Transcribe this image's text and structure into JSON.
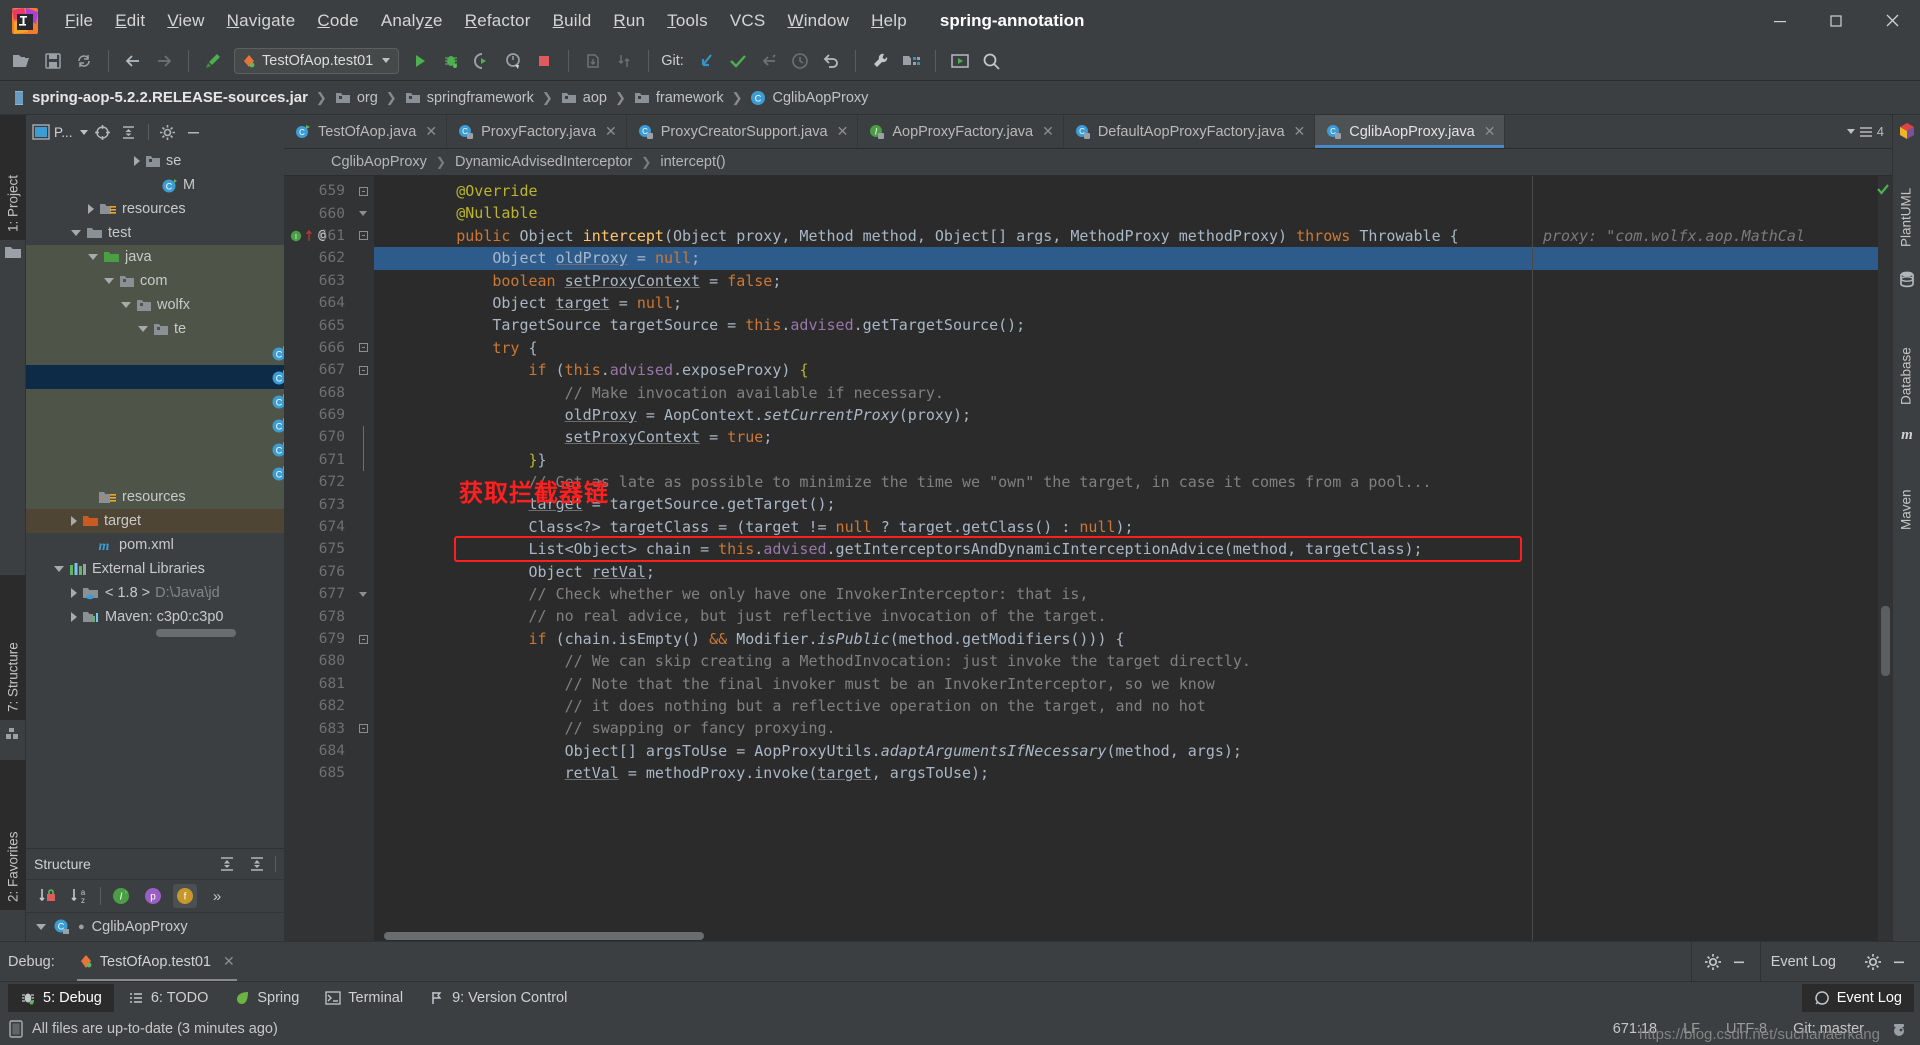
{
  "window": {
    "title": "spring-annotation",
    "minimize_label": "–",
    "maximize_label": "□",
    "close_label": "✕"
  },
  "menu": [
    {
      "label": "File",
      "mnemonic": "F"
    },
    {
      "label": "Edit",
      "mnemonic": "E"
    },
    {
      "label": "View",
      "mnemonic": "V"
    },
    {
      "label": "Navigate",
      "mnemonic": "N"
    },
    {
      "label": "Code",
      "mnemonic": "C"
    },
    {
      "label": "Analyze",
      "mnemonic": "z"
    },
    {
      "label": "Refactor",
      "mnemonic": "R"
    },
    {
      "label": "Build",
      "mnemonic": "B"
    },
    {
      "label": "Run",
      "mnemonic": "R"
    },
    {
      "label": "Tools",
      "mnemonic": "T"
    },
    {
      "label": "VCS",
      "mnemonic": ""
    },
    {
      "label": "Window",
      "mnemonic": "W"
    },
    {
      "label": "Help",
      "mnemonic": "H"
    }
  ],
  "toolbar": {
    "run_config": "TestOfAop.test01",
    "git_label": "Git:",
    "icons": [
      "open-folder-icon",
      "save-all-icon",
      "sync-icon",
      "back-arrow-icon",
      "forward-arrow-icon",
      "build-icon",
      "run-icon",
      "debug-icon",
      "run-coverage-icon",
      "profile-icon",
      "stop-icon",
      "update-project-icon",
      "commit-icon",
      "git-update-icon",
      "git-commit-check-icon",
      "git-push-icon",
      "git-history-icon",
      "git-rollback-icon",
      "settings-wrench-icon",
      "project-structure-icon",
      "run-anything-icon",
      "search-everywhere-icon"
    ]
  },
  "breadcrumb": {
    "items": [
      {
        "label": "spring-aop-5.2.2.RELEASE-sources.jar",
        "icon": "jar-icon"
      },
      {
        "label": "org",
        "icon": "package-icon"
      },
      {
        "label": "springframework",
        "icon": "package-icon"
      },
      {
        "label": "aop",
        "icon": "package-icon"
      },
      {
        "label": "framework",
        "icon": "package-icon"
      },
      {
        "label": "CglibAopProxy",
        "icon": "class-icon"
      }
    ]
  },
  "left_rail": {
    "project_tab": "1: Project",
    "structure_tab": "7: Structure",
    "favorites_tab": "2: Favorites"
  },
  "right_rail": {
    "items": [
      "PlantUML",
      "Database",
      "Maven"
    ]
  },
  "project_panel": {
    "title": "P...",
    "tree": [
      {
        "label": "se",
        "indent": 5,
        "arrow": "closed",
        "icon": "folder-icon",
        "sel": ""
      },
      {
        "label": "M",
        "indent": 6,
        "arrow": "none",
        "icon": "test-class-icon",
        "sel": ""
      },
      {
        "label": "resources",
        "indent": 3,
        "arrow": "closed",
        "icon": "resources-folder-icon",
        "sel": ""
      },
      {
        "label": "test",
        "indent": 2,
        "arrow": "open",
        "icon": "folder-icon",
        "sel": ""
      },
      {
        "label": "java",
        "indent": 3,
        "arrow": "open",
        "icon": "source-folder-green-icon",
        "sel": "sel-green"
      },
      {
        "label": "com",
        "indent": 4,
        "arrow": "open",
        "icon": "package-icon",
        "sel": "sel-green"
      },
      {
        "label": "wolfx",
        "indent": 5,
        "arrow": "open",
        "icon": "package-icon",
        "sel": "sel-green"
      },
      {
        "label": "te",
        "indent": 6,
        "arrow": "open",
        "icon": "package-icon",
        "sel": "sel-green"
      },
      {
        "label": "",
        "indent": 7,
        "arrow": "none",
        "icon": "test-class-icon",
        "sel": "sel-green"
      },
      {
        "label": "",
        "indent": 7,
        "arrow": "none",
        "icon": "test-class-icon",
        "sel": "sel-blue"
      },
      {
        "label": "",
        "indent": 7,
        "arrow": "none",
        "icon": "test-class-icon",
        "sel": "sel-green"
      },
      {
        "label": "",
        "indent": 7,
        "arrow": "none",
        "icon": "test-class-icon",
        "sel": "sel-green"
      },
      {
        "label": "",
        "indent": 7,
        "arrow": "none",
        "icon": "test-class-icon",
        "sel": "sel-green"
      },
      {
        "label": "",
        "indent": 7,
        "arrow": "none",
        "icon": "test-class-icon",
        "sel": "sel-green"
      },
      {
        "label": "resources",
        "indent": 3,
        "arrow": "none",
        "icon": "test-resources-folder-icon",
        "sel": "sel-green"
      },
      {
        "label": "target",
        "indent": 2,
        "arrow": "closed",
        "icon": "target-folder-icon",
        "sel": "sel-amber"
      },
      {
        "label": "pom.xml",
        "indent": 3,
        "arrow": "none",
        "icon": "maven-m-icon",
        "sel": ""
      },
      {
        "label": "External Libraries",
        "indent": 1,
        "arrow": "open",
        "icon": "libraries-icon",
        "sel": ""
      },
      {
        "label": "< 1.8 >",
        "sublabel": "D:\\Java\\jd",
        "indent": 2,
        "arrow": "closed",
        "icon": "jdk-icon",
        "sel": ""
      },
      {
        "label": "Maven: c3p0:c3p0",
        "indent": 2,
        "arrow": "closed",
        "icon": "maven-lib-icon",
        "sel": ""
      }
    ]
  },
  "structure_panel": {
    "title": "Structure",
    "root_item": "CglibAopProxy",
    "toolbar_icons": [
      "sort-by-visibility-icon",
      "sort-alphabetically-icon",
      "show-inherited-icon",
      "show-properties-icon",
      "show-fields-icon",
      "more-icon"
    ]
  },
  "editor_tabs": [
    {
      "label": "TestOfAop.java",
      "icon": "test-class-icon",
      "active": false
    },
    {
      "label": "ProxyFactory.java",
      "icon": "class-locked-icon",
      "active": false
    },
    {
      "label": "ProxyCreatorSupport.java",
      "icon": "class-locked-icon",
      "active": false
    },
    {
      "label": "AopProxyFactory.java",
      "icon": "interface-locked-icon",
      "active": false
    },
    {
      "label": "DefaultAopProxyFactory.java",
      "icon": "class-locked-icon",
      "active": false
    },
    {
      "label": "CglibAopProxy.java",
      "icon": "class-locked-icon",
      "active": true
    }
  ],
  "editor_tabs_overflow": "4",
  "editor_breadcrumb": [
    "CglibAopProxy",
    "DynamicAdvisedInterceptor",
    "intercept()"
  ],
  "code": {
    "first_line": 659,
    "lines": [
      {
        "n": 659,
        "indent": 2,
        "tokens": [
          {
            "t": "@Override",
            "c": "ann"
          }
        ]
      },
      {
        "n": 660,
        "indent": 2,
        "tokens": [
          {
            "t": "@Nullable",
            "c": "ann"
          }
        ]
      },
      {
        "n": 661,
        "indent": 2,
        "tokens": [
          {
            "t": "public ",
            "c": "kw"
          },
          {
            "t": "Object ",
            "c": "pl"
          },
          {
            "t": "intercept",
            "c": "mth"
          },
          {
            "t": "(Object proxy, Method method, Object[] args, MethodProxy methodProxy) ",
            "c": "pl"
          },
          {
            "t": "throws ",
            "c": "kw"
          },
          {
            "t": "Throwable {",
            "c": "pl"
          }
        ]
      },
      {
        "n": 662,
        "indent": 3,
        "highlight": true,
        "tokens": [
          {
            "t": "Object ",
            "c": "pl"
          },
          {
            "t": "oldProxy",
            "c": "pl und"
          },
          {
            "t": " = ",
            "c": "pl"
          },
          {
            "t": "null",
            "c": "kw"
          },
          {
            "t": ";",
            "c": "pl"
          }
        ]
      },
      {
        "n": 663,
        "indent": 3,
        "tokens": [
          {
            "t": "boolean ",
            "c": "kw"
          },
          {
            "t": "setProxyContext",
            "c": "pl und"
          },
          {
            "t": " = ",
            "c": "pl"
          },
          {
            "t": "false",
            "c": "kw"
          },
          {
            "t": ";",
            "c": "pl"
          }
        ]
      },
      {
        "n": 664,
        "indent": 3,
        "tokens": [
          {
            "t": "Object ",
            "c": "pl"
          },
          {
            "t": "target",
            "c": "pl und"
          },
          {
            "t": " = ",
            "c": "pl"
          },
          {
            "t": "null",
            "c": "kw"
          },
          {
            "t": ";",
            "c": "pl"
          }
        ]
      },
      {
        "n": 665,
        "indent": 3,
        "tokens": [
          {
            "t": "TargetSource targetSource = ",
            "c": "pl"
          },
          {
            "t": "this",
            "c": "kw"
          },
          {
            "t": ".",
            "c": "pl"
          },
          {
            "t": "advised",
            "c": "fld"
          },
          {
            "t": ".getTargetSource();",
            "c": "pl"
          }
        ]
      },
      {
        "n": 666,
        "indent": 3,
        "tokens": [
          {
            "t": "try ",
            "c": "kw"
          },
          {
            "t": "{",
            "c": "pl"
          }
        ]
      },
      {
        "n": 667,
        "indent": 4,
        "tokens": [
          {
            "t": "if ",
            "c": "kw"
          },
          {
            "t": "(",
            "c": "pl"
          },
          {
            "t": "this",
            "c": "kw"
          },
          {
            "t": ".",
            "c": "pl"
          },
          {
            "t": "advised",
            "c": "fld"
          },
          {
            "t": ".exposeProxy) ",
            "c": "pl"
          },
          {
            "t": "{",
            "c": "ann"
          }
        ]
      },
      {
        "n": 668,
        "indent": 5,
        "tokens": [
          {
            "t": "// Make invocation available if necessary.",
            "c": "cmt"
          }
        ]
      },
      {
        "n": 669,
        "indent": 5,
        "tokens": [
          {
            "t": "oldProxy",
            "c": "pl und"
          },
          {
            "t": " = AopContext.",
            "c": "pl"
          },
          {
            "t": "setCurrentProxy",
            "c": "pl stat"
          },
          {
            "t": "(proxy);",
            "c": "pl"
          }
        ]
      },
      {
        "n": 670,
        "indent": 5,
        "tokens": [
          {
            "t": "setProxyContext",
            "c": "pl und"
          },
          {
            "t": " = ",
            "c": "pl"
          },
          {
            "t": "true",
            "c": "kw"
          },
          {
            "t": ";",
            "c": "pl"
          }
        ]
      },
      {
        "n": 671,
        "indent": 4,
        "tokens": [
          {
            "t": "}",
            "c": "ann"
          },
          {
            "t": "}",
            "c": "pl"
          }
        ]
      },
      {
        "n": 672,
        "indent": 4,
        "tokens": [
          {
            "t": "// Get as late as possible to minimize the time we \"own\" the target, in case it comes from a pool...",
            "c": "cmt"
          }
        ]
      },
      {
        "n": 673,
        "indent": 4,
        "tokens": [
          {
            "t": "target",
            "c": "pl und"
          },
          {
            "t": " = targetSource.getTarget();",
            "c": "pl"
          }
        ]
      },
      {
        "n": 674,
        "indent": 4,
        "tokens": [
          {
            "t": "Class<?> targetClass = (target != ",
            "c": "pl"
          },
          {
            "t": "null",
            "c": "kw"
          },
          {
            "t": " ? target.getClass() : ",
            "c": "pl"
          },
          {
            "t": "null",
            "c": "kw"
          },
          {
            "t": ");",
            "c": "pl"
          }
        ]
      },
      {
        "n": 675,
        "indent": 4,
        "boxed": true,
        "tokens": [
          {
            "t": "List<Object> chain = ",
            "c": "pl"
          },
          {
            "t": "this",
            "c": "kw"
          },
          {
            "t": ".",
            "c": "pl"
          },
          {
            "t": "advised",
            "c": "fld"
          },
          {
            "t": ".getInterceptorsAndDynamicInterceptionAdvice(method, targetClass);",
            "c": "pl"
          }
        ]
      },
      {
        "n": 676,
        "indent": 4,
        "tokens": [
          {
            "t": "Object ",
            "c": "pl"
          },
          {
            "t": "retVal",
            "c": "pl und"
          },
          {
            "t": ";",
            "c": "pl"
          }
        ]
      },
      {
        "n": 677,
        "indent": 4,
        "tokens": [
          {
            "t": "// Check whether we only have one InvokerInterceptor: that is,",
            "c": "cmt"
          }
        ]
      },
      {
        "n": 678,
        "indent": 4,
        "tokens": [
          {
            "t": "// no real advice, but just reflective invocation of the target.",
            "c": "cmt"
          }
        ]
      },
      {
        "n": 679,
        "indent": 4,
        "tokens": [
          {
            "t": "if ",
            "c": "kw"
          },
          {
            "t": "(chain.isEmpty() ",
            "c": "pl"
          },
          {
            "t": "&& ",
            "c": "kw"
          },
          {
            "t": "Modifier.",
            "c": "pl"
          },
          {
            "t": "isPublic",
            "c": "pl stat"
          },
          {
            "t": "(method.getModifiers())) {",
            "c": "pl"
          }
        ]
      },
      {
        "n": 680,
        "indent": 5,
        "tokens": [
          {
            "t": "// We can skip creating a MethodInvocation: just invoke the target directly.",
            "c": "cmt"
          }
        ]
      },
      {
        "n": 681,
        "indent": 5,
        "tokens": [
          {
            "t": "// Note that the final invoker must be an InvokerInterceptor, so we know",
            "c": "cmt"
          }
        ]
      },
      {
        "n": 682,
        "indent": 5,
        "tokens": [
          {
            "t": "// it does nothing but a reflective operation on the target, and no hot",
            "c": "cmt"
          }
        ]
      },
      {
        "n": 683,
        "indent": 5,
        "tokens": [
          {
            "t": "// swapping or fancy proxying.",
            "c": "cmt"
          }
        ]
      },
      {
        "n": 684,
        "indent": 5,
        "tokens": [
          {
            "t": "Object[] argsToUse = AopProxyUtils.",
            "c": "pl"
          },
          {
            "t": "adaptArgumentsIfNecessary",
            "c": "pl stat"
          },
          {
            "t": "(method, args);",
            "c": "pl"
          }
        ]
      },
      {
        "n": 685,
        "indent": 5,
        "tokens": [
          {
            "t": "retVal",
            "c": "pl und"
          },
          {
            "t": " = methodProxy.invoke(",
            "c": "pl"
          },
          {
            "t": "target",
            "c": "pl und"
          },
          {
            "t": ", argsToUse);",
            "c": "pl"
          }
        ]
      }
    ]
  },
  "debug_hints": [
    {
      "line": 661,
      "text": "proxy: \"com.wolfx.aop.MathCal"
    }
  ],
  "annotations": {
    "red_text": "获取拦截器链",
    "red_box_line": 675
  },
  "debug_panel": {
    "label": "Debug:",
    "session": "TestOfAop.test01",
    "close_label": "✕",
    "event_log_title": "Event Log",
    "settings_icon": "gear-icon",
    "hide_icon": "minimize-icon"
  },
  "tool_buttons": [
    {
      "label": "5: Debug",
      "mnemonic": "5",
      "icon": "debug-bug-icon",
      "active": true
    },
    {
      "label": "6: TODO",
      "mnemonic": "6",
      "icon": "todo-list-icon",
      "active": false
    },
    {
      "label": "Spring",
      "mnemonic": "",
      "icon": "spring-leaf-icon",
      "active": false
    },
    {
      "label": "Terminal",
      "mnemonic": "",
      "icon": "terminal-icon",
      "active": false
    },
    {
      "label": "9: Version Control",
      "mnemonic": "9",
      "icon": "branch-icon",
      "active": false
    }
  ],
  "tool_buttons_right": [
    {
      "label": "Event Log",
      "icon": "event-log-icon"
    }
  ],
  "statusbar": {
    "message": "All files are up-to-date (3 minutes ago)",
    "caret": "671:18",
    "line_separator": "LF",
    "encoding": "UTF-8",
    "branch": "Git: master",
    "watermark": "https://blog.csdn.net/suchanaerkang"
  },
  "colors": {
    "accent_blue": "#4a88c7",
    "selection_blue": "#2d5c8c",
    "annotation_red": "#ff1f1f",
    "keyword_orange": "#cc7832",
    "comment_gray": "#808080",
    "field_purple": "#9876aa",
    "method_yellow": "#ffc66d",
    "panel_bg": "#3c3f41",
    "editor_bg": "#2b2b2b"
  }
}
